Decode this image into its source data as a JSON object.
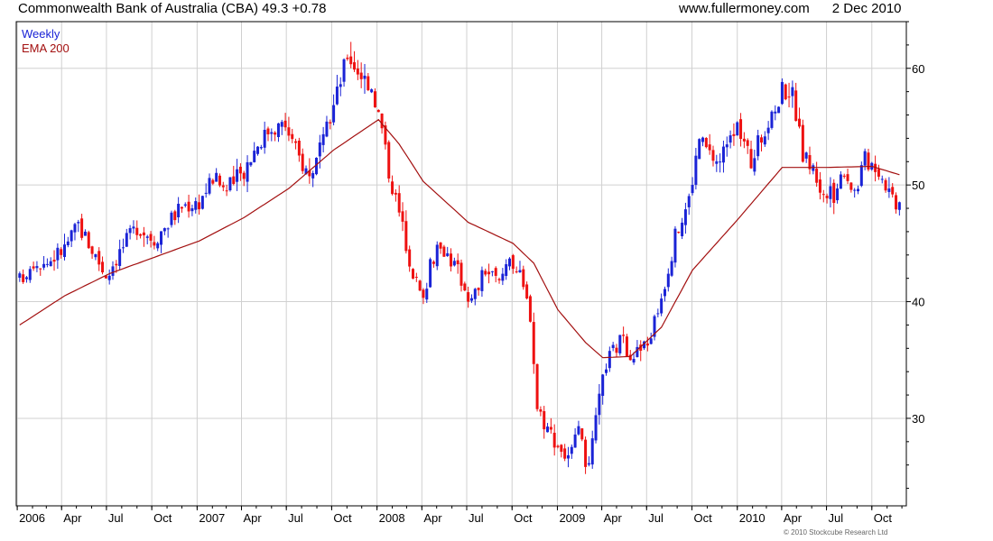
{
  "header": {
    "title": "Commonwealth Bank of Australia (CBA) 49.3 +0.78",
    "site": "www.fullermoney.com",
    "date": "2 Dec 2010"
  },
  "footer": {
    "copyright": "© 2010 Stockcube Research Ltd"
  },
  "colors": {
    "up": "#1a23d6",
    "down": "#ee1111",
    "ema": "#a31010",
    "grid": "#d0d0d0",
    "frame": "#000000"
  },
  "chart_data": {
    "type": "candlestick",
    "title": "Commonwealth Bank of Australia (CBA) 49.3 +0.78",
    "legend": [
      {
        "label": "Weekly",
        "color": "#1a23d6"
      },
      {
        "label": "EMA 200",
        "color": "#a31010"
      }
    ],
    "legend_position": "top-left",
    "grid": true,
    "y_axis": {
      "position": "right",
      "ylim": [
        22.5,
        64
      ],
      "ticks": [
        30,
        40,
        50,
        60
      ]
    },
    "x_axis": {
      "range": [
        "2005-12-30",
        "2010-12-10"
      ],
      "ticks": [
        {
          "label": "2006",
          "date": "2006-01-01"
        },
        {
          "label": "Apr",
          "date": "2006-04-01"
        },
        {
          "label": "Jul",
          "date": "2006-07-01"
        },
        {
          "label": "Oct",
          "date": "2006-10-01"
        },
        {
          "label": "2007",
          "date": "2007-01-01"
        },
        {
          "label": "Apr",
          "date": "2007-04-01"
        },
        {
          "label": "Jul",
          "date": "2007-07-01"
        },
        {
          "label": "Oct",
          "date": "2007-10-01"
        },
        {
          "label": "2008",
          "date": "2008-01-01"
        },
        {
          "label": "Apr",
          "date": "2008-04-01"
        },
        {
          "label": "Jul",
          "date": "2008-07-01"
        },
        {
          "label": "Oct",
          "date": "2008-10-01"
        },
        {
          "label": "2009",
          "date": "2009-01-01"
        },
        {
          "label": "Apr",
          "date": "2009-04-01"
        },
        {
          "label": "Jul",
          "date": "2009-07-01"
        },
        {
          "label": "Oct",
          "date": "2009-10-01"
        },
        {
          "label": "2010",
          "date": "2010-01-01"
        },
        {
          "label": "Apr",
          "date": "2010-04-01"
        },
        {
          "label": "Jul",
          "date": "2010-07-01"
        },
        {
          "label": "Oct",
          "date": "2010-10-01"
        }
      ]
    },
    "weekly_close_approx": [
      [
        "2006-01-06",
        41.8
      ],
      [
        "2006-02-03",
        43.6
      ],
      [
        "2006-03-03",
        43.4
      ],
      [
        "2006-04-07",
        44.6
      ],
      [
        "2006-05-05",
        46.6
      ],
      [
        "2006-06-02",
        44.5
      ],
      [
        "2006-06-30",
        42.3
      ],
      [
        "2006-07-28",
        44.3
      ],
      [
        "2006-09-01",
        46.5
      ],
      [
        "2006-10-06",
        45.4
      ],
      [
        "2006-11-03",
        46.8
      ],
      [
        "2006-12-01",
        48.2
      ],
      [
        "2007-01-05",
        48.6
      ],
      [
        "2007-02-02",
        50.6
      ],
      [
        "2007-03-02",
        49.6
      ],
      [
        "2007-04-06",
        51.3
      ],
      [
        "2007-05-04",
        53.6
      ],
      [
        "2007-06-01",
        55.0
      ],
      [
        "2007-06-29",
        55.1
      ],
      [
        "2007-07-27",
        52.3
      ],
      [
        "2007-08-17",
        50.8
      ],
      [
        "2007-09-14",
        53.6
      ],
      [
        "2007-10-12",
        57.9
      ],
      [
        "2007-11-02",
        61.2
      ],
      [
        "2007-11-23",
        59.8
      ],
      [
        "2007-12-21",
        58.5
      ],
      [
        "2008-01-11",
        54.8
      ],
      [
        "2008-01-25",
        51.2
      ],
      [
        "2008-02-15",
        47.6
      ],
      [
        "2008-03-07",
        43.8
      ],
      [
        "2008-03-21",
        41.6
      ],
      [
        "2008-04-04",
        39.9
      ],
      [
        "2008-04-18",
        43.7
      ],
      [
        "2008-05-16",
        44.6
      ],
      [
        "2008-06-13",
        42.6
      ],
      [
        "2008-07-11",
        40.0
      ],
      [
        "2008-08-08",
        42.8
      ],
      [
        "2008-09-05",
        41.5
      ],
      [
        "2008-09-26",
        44.2
      ],
      [
        "2008-10-17",
        42.0
      ],
      [
        "2008-11-07",
        39.0
      ],
      [
        "2008-11-21",
        31.0
      ],
      [
        "2008-12-12",
        29.2
      ],
      [
        "2009-01-02",
        27.8
      ],
      [
        "2009-01-23",
        26.4
      ],
      [
        "2009-02-13",
        28.6
      ],
      [
        "2009-03-06",
        25.4
      ],
      [
        "2009-03-20",
        29.8
      ],
      [
        "2009-04-10",
        34.8
      ],
      [
        "2009-05-08",
        36.6
      ],
      [
        "2009-06-05",
        35.5
      ],
      [
        "2009-07-03",
        36.3
      ],
      [
        "2009-07-31",
        40.5
      ],
      [
        "2009-08-28",
        45.5
      ],
      [
        "2009-09-25",
        48.8
      ],
      [
        "2009-10-16",
        54.0
      ],
      [
        "2009-11-06",
        52.6
      ],
      [
        "2009-11-27",
        51.9
      ],
      [
        "2009-12-18",
        55.0
      ],
      [
        "2010-01-08",
        54.4
      ],
      [
        "2010-01-29",
        51.9
      ],
      [
        "2010-02-19",
        54.3
      ],
      [
        "2010-03-12",
        55.6
      ],
      [
        "2010-04-02",
        58.3
      ],
      [
        "2010-04-23",
        57.8
      ],
      [
        "2010-05-14",
        52.6
      ],
      [
        "2010-06-04",
        51.4
      ],
      [
        "2010-06-25",
        49.0
      ],
      [
        "2010-07-16",
        49.2
      ],
      [
        "2010-08-06",
        51.5
      ],
      [
        "2010-08-27",
        49.4
      ],
      [
        "2010-09-17",
        52.2
      ],
      [
        "2010-10-08",
        51.8
      ],
      [
        "2010-10-29",
        50.2
      ],
      [
        "2010-11-19",
        48.6
      ],
      [
        "2010-12-02",
        49.3
      ]
    ],
    "ema200_approx": [
      [
        "2006-01-06",
        38.0
      ],
      [
        "2006-04-07",
        40.5
      ],
      [
        "2006-07-07",
        42.4
      ],
      [
        "2006-10-06",
        43.8
      ],
      [
        "2007-01-05",
        45.2
      ],
      [
        "2007-04-06",
        47.2
      ],
      [
        "2007-07-06",
        49.7
      ],
      [
        "2007-10-05",
        53.0
      ],
      [
        "2008-01-04",
        55.6
      ],
      [
        "2008-02-15",
        53.5
      ],
      [
        "2008-04-04",
        50.3
      ],
      [
        "2008-07-04",
        46.8
      ],
      [
        "2008-10-03",
        45.0
      ],
      [
        "2008-11-14",
        43.3
      ],
      [
        "2009-01-02",
        39.3
      ],
      [
        "2009-02-27",
        36.5
      ],
      [
        "2009-04-03",
        35.2
      ],
      [
        "2009-05-29",
        35.3
      ],
      [
        "2009-07-31",
        37.8
      ],
      [
        "2009-10-02",
        42.7
      ],
      [
        "2010-01-01",
        47.0
      ],
      [
        "2010-04-02",
        51.5
      ],
      [
        "2010-07-02",
        51.5
      ],
      [
        "2010-10-01",
        51.6
      ],
      [
        "2010-12-02",
        50.8
      ]
    ]
  }
}
